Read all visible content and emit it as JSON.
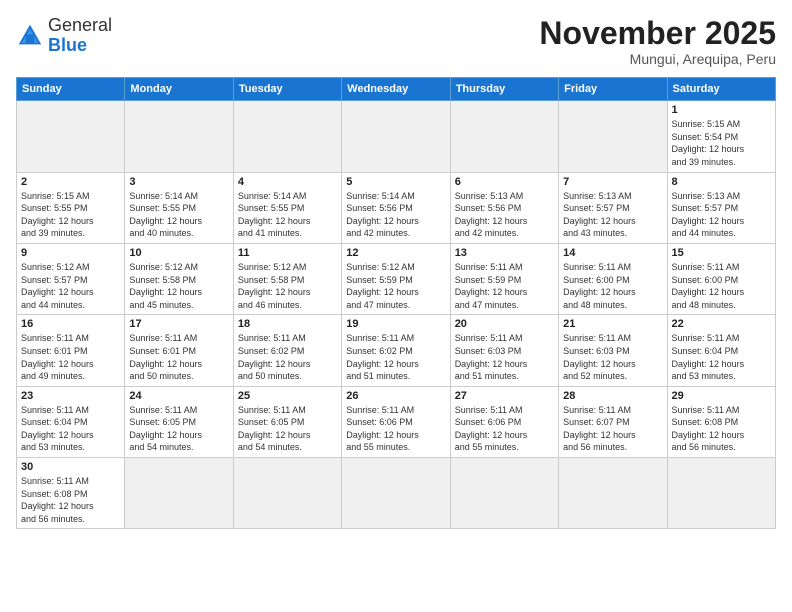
{
  "header": {
    "logo_general": "General",
    "logo_blue": "Blue",
    "month_title": "November 2025",
    "subtitle": "Mungui, Arequipa, Peru"
  },
  "weekdays": [
    "Sunday",
    "Monday",
    "Tuesday",
    "Wednesday",
    "Thursday",
    "Friday",
    "Saturday"
  ],
  "weeks": [
    [
      {
        "day": "",
        "info": ""
      },
      {
        "day": "",
        "info": ""
      },
      {
        "day": "",
        "info": ""
      },
      {
        "day": "",
        "info": ""
      },
      {
        "day": "",
        "info": ""
      },
      {
        "day": "",
        "info": ""
      },
      {
        "day": "1",
        "info": "Sunrise: 5:15 AM\nSunset: 5:54 PM\nDaylight: 12 hours\nand 39 minutes."
      }
    ],
    [
      {
        "day": "2",
        "info": "Sunrise: 5:15 AM\nSunset: 5:55 PM\nDaylight: 12 hours\nand 39 minutes."
      },
      {
        "day": "3",
        "info": "Sunrise: 5:14 AM\nSunset: 5:55 PM\nDaylight: 12 hours\nand 40 minutes."
      },
      {
        "day": "4",
        "info": "Sunrise: 5:14 AM\nSunset: 5:55 PM\nDaylight: 12 hours\nand 41 minutes."
      },
      {
        "day": "5",
        "info": "Sunrise: 5:14 AM\nSunset: 5:56 PM\nDaylight: 12 hours\nand 42 minutes."
      },
      {
        "day": "6",
        "info": "Sunrise: 5:13 AM\nSunset: 5:56 PM\nDaylight: 12 hours\nand 42 minutes."
      },
      {
        "day": "7",
        "info": "Sunrise: 5:13 AM\nSunset: 5:57 PM\nDaylight: 12 hours\nand 43 minutes."
      },
      {
        "day": "8",
        "info": "Sunrise: 5:13 AM\nSunset: 5:57 PM\nDaylight: 12 hours\nand 44 minutes."
      }
    ],
    [
      {
        "day": "9",
        "info": "Sunrise: 5:12 AM\nSunset: 5:57 PM\nDaylight: 12 hours\nand 44 minutes."
      },
      {
        "day": "10",
        "info": "Sunrise: 5:12 AM\nSunset: 5:58 PM\nDaylight: 12 hours\nand 45 minutes."
      },
      {
        "day": "11",
        "info": "Sunrise: 5:12 AM\nSunset: 5:58 PM\nDaylight: 12 hours\nand 46 minutes."
      },
      {
        "day": "12",
        "info": "Sunrise: 5:12 AM\nSunset: 5:59 PM\nDaylight: 12 hours\nand 47 minutes."
      },
      {
        "day": "13",
        "info": "Sunrise: 5:11 AM\nSunset: 5:59 PM\nDaylight: 12 hours\nand 47 minutes."
      },
      {
        "day": "14",
        "info": "Sunrise: 5:11 AM\nSunset: 6:00 PM\nDaylight: 12 hours\nand 48 minutes."
      },
      {
        "day": "15",
        "info": "Sunrise: 5:11 AM\nSunset: 6:00 PM\nDaylight: 12 hours\nand 48 minutes."
      }
    ],
    [
      {
        "day": "16",
        "info": "Sunrise: 5:11 AM\nSunset: 6:01 PM\nDaylight: 12 hours\nand 49 minutes."
      },
      {
        "day": "17",
        "info": "Sunrise: 5:11 AM\nSunset: 6:01 PM\nDaylight: 12 hours\nand 50 minutes."
      },
      {
        "day": "18",
        "info": "Sunrise: 5:11 AM\nSunset: 6:02 PM\nDaylight: 12 hours\nand 50 minutes."
      },
      {
        "day": "19",
        "info": "Sunrise: 5:11 AM\nSunset: 6:02 PM\nDaylight: 12 hours\nand 51 minutes."
      },
      {
        "day": "20",
        "info": "Sunrise: 5:11 AM\nSunset: 6:03 PM\nDaylight: 12 hours\nand 51 minutes."
      },
      {
        "day": "21",
        "info": "Sunrise: 5:11 AM\nSunset: 6:03 PM\nDaylight: 12 hours\nand 52 minutes."
      },
      {
        "day": "22",
        "info": "Sunrise: 5:11 AM\nSunset: 6:04 PM\nDaylight: 12 hours\nand 53 minutes."
      }
    ],
    [
      {
        "day": "23",
        "info": "Sunrise: 5:11 AM\nSunset: 6:04 PM\nDaylight: 12 hours\nand 53 minutes."
      },
      {
        "day": "24",
        "info": "Sunrise: 5:11 AM\nSunset: 6:05 PM\nDaylight: 12 hours\nand 54 minutes."
      },
      {
        "day": "25",
        "info": "Sunrise: 5:11 AM\nSunset: 6:05 PM\nDaylight: 12 hours\nand 54 minutes."
      },
      {
        "day": "26",
        "info": "Sunrise: 5:11 AM\nSunset: 6:06 PM\nDaylight: 12 hours\nand 55 minutes."
      },
      {
        "day": "27",
        "info": "Sunrise: 5:11 AM\nSunset: 6:06 PM\nDaylight: 12 hours\nand 55 minutes."
      },
      {
        "day": "28",
        "info": "Sunrise: 5:11 AM\nSunset: 6:07 PM\nDaylight: 12 hours\nand 56 minutes."
      },
      {
        "day": "29",
        "info": "Sunrise: 5:11 AM\nSunset: 6:08 PM\nDaylight: 12 hours\nand 56 minutes."
      }
    ],
    [
      {
        "day": "30",
        "info": "Sunrise: 5:11 AM\nSunset: 6:08 PM\nDaylight: 12 hours\nand 56 minutes."
      },
      {
        "day": "",
        "info": ""
      },
      {
        "day": "",
        "info": ""
      },
      {
        "day": "",
        "info": ""
      },
      {
        "day": "",
        "info": ""
      },
      {
        "day": "",
        "info": ""
      },
      {
        "day": "",
        "info": ""
      }
    ]
  ]
}
